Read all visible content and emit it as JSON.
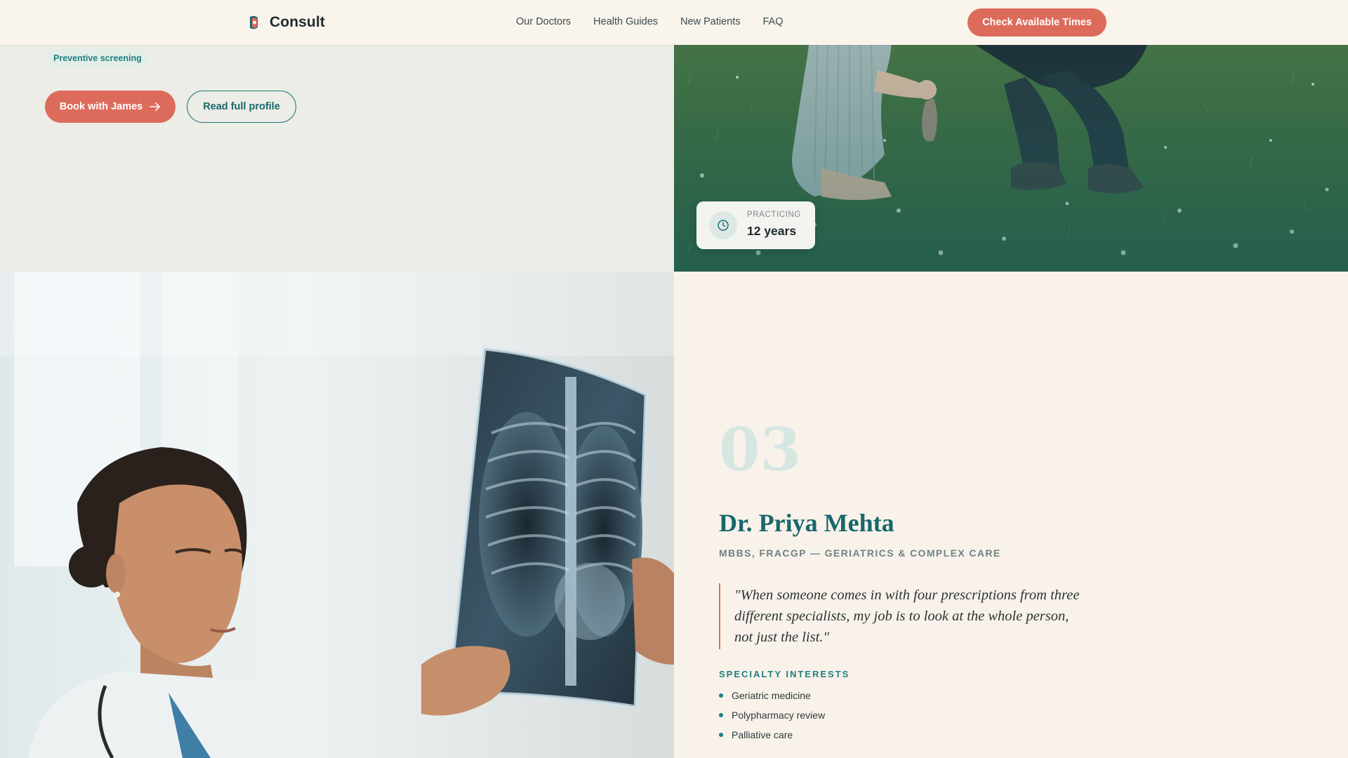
{
  "header": {
    "brand_name": "Consult",
    "nav": [
      "Our Doctors",
      "Health Guides",
      "New Patients",
      "FAQ"
    ],
    "cta_label": "Check Available Times"
  },
  "previous_doctor": {
    "tag": "Preventive screening",
    "book_label": "Book with James",
    "book_icon": "arrow-right-icon",
    "read_label": "Read full profile",
    "stat": {
      "icon": "clock-icon",
      "label": "PRACTICING",
      "value": "12 years"
    }
  },
  "doctor": {
    "number": "03",
    "name": "Dr. Priya Mehta",
    "credentials": "MBBS, FRACGP — GERIATRICS & COMPLEX CARE",
    "quote": "\"When someone comes in with four prescriptions from three different specialists, my job is to look at the whole person, not just the list.\"",
    "specialty_heading": "SPECIALTY INTERESTS",
    "specialties": [
      "Geriatric medicine",
      "Polypharmacy review",
      "Palliative care"
    ]
  },
  "colors": {
    "accent": "#dd6b5b",
    "teal": "#17686b",
    "cream": "#f9f2ea"
  }
}
